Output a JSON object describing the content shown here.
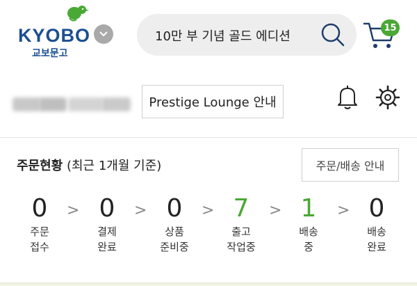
{
  "header": {
    "logo_text": "KYOBO",
    "logo_subtext": "교보문고",
    "search_text": "10만 부 기념 골드 에디션",
    "cart_count": "15"
  },
  "user": {
    "lounge_button": "Prestige Lounge 안내"
  },
  "order_status": {
    "title_bold": "주문현황",
    "title_sub": " (최근 1개월 기준)",
    "guide_button": "주문/배송 안내",
    "steps": [
      {
        "count": "0",
        "line1": "주문",
        "line2": "접수"
      },
      {
        "count": "0",
        "line1": "결제",
        "line2": "완료"
      },
      {
        "count": "0",
        "line1": "상품",
        "line2": "준비중"
      },
      {
        "count": "7",
        "line1": "출고",
        "line2": "작업중"
      },
      {
        "count": "1",
        "line1": "배송",
        "line2": "중"
      },
      {
        "count": "0",
        "line1": "배송",
        "line2": "완료"
      }
    ]
  },
  "colors": {
    "brand_blue": "#1b4e91",
    "brand_green": "#4aa835"
  }
}
